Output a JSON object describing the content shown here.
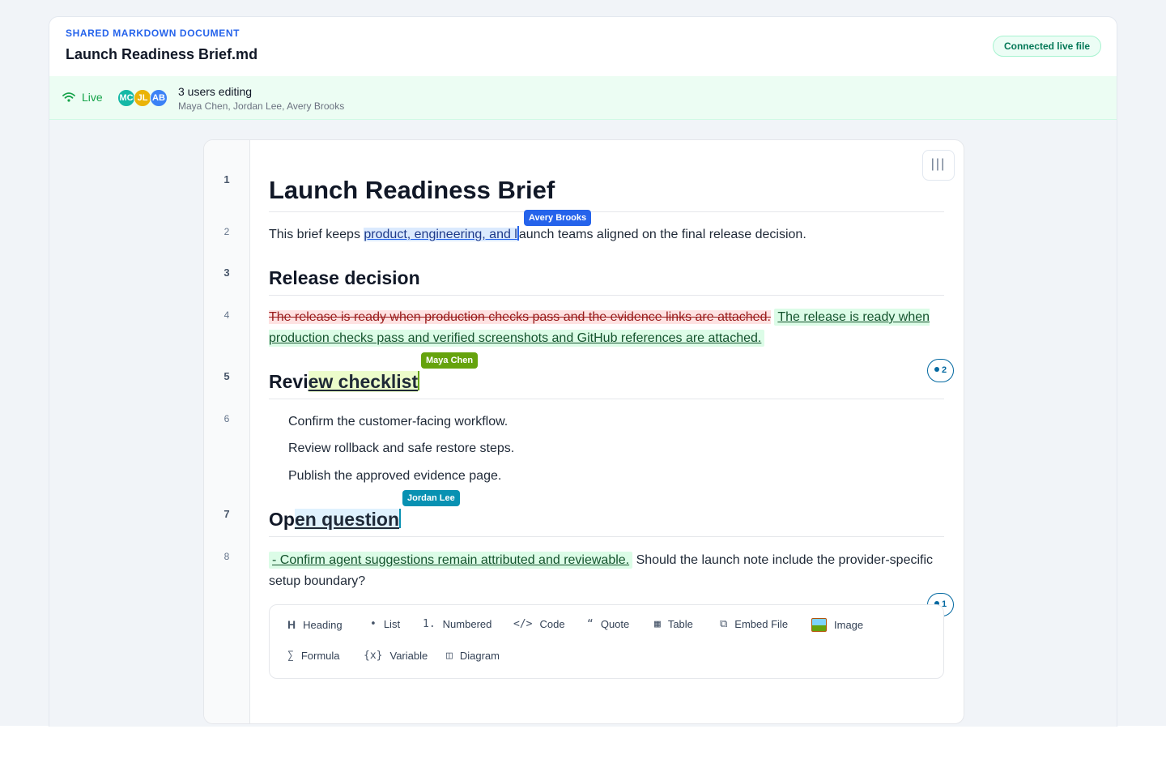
{
  "header": {
    "eyebrow": "SHARED MARKDOWN DOCUMENT",
    "title": "Launch Readiness Brief.md",
    "connection_badge": "Connected live file"
  },
  "presence": {
    "live_label": "Live",
    "avatars": [
      {
        "initials": "MC",
        "color": "#14b8a6"
      },
      {
        "initials": "JL",
        "color": "#eab308"
      },
      {
        "initials": "AB",
        "color": "#3b82f6"
      }
    ],
    "count_label": "3 users editing",
    "names": "Maya Chen, Jordan Lee, Avery Brooks"
  },
  "gutter": {
    "line_numbers": [
      "1",
      "2",
      "3",
      "4",
      "5",
      "6",
      "7",
      "8"
    ]
  },
  "toggle_icon": "column-toggle-icon",
  "doc": {
    "h1": "Launch Readiness Brief",
    "p2": {
      "before": "This brief keeps ",
      "selected": "product, engineering, and l",
      "after": "aunch teams aligned on the final release decision.",
      "cursor_user": "Avery Brooks",
      "cursor_color": "#2563eb"
    },
    "h2_release": "Release decision",
    "p4": {
      "deleted": "The release is ready when production checks pass and the evidence links are attached.",
      "inserted": "The release is ready when production checks pass and verified screenshots and GitHub references are attached."
    },
    "h2_review": {
      "plain": "Revi",
      "highlighted": "ew checklist",
      "cursor_user": "Maya Chen",
      "cursor_color": "#65a30d"
    },
    "review_comment_count": "2",
    "checklist": [
      "Confirm the customer-facing workflow.",
      "Review rollback and safe restore steps.",
      "Publish the approved evidence page."
    ],
    "h2_open": {
      "plain": "Op",
      "highlighted": "en question",
      "cursor_user": "Jordan Lee",
      "cursor_color": "#0891b2"
    },
    "p8": {
      "suggested": "- Confirm agent suggestions remain attributed and reviewable.",
      "rest": " Should the launch note include the provider-specific setup boundary?"
    },
    "open_comment_count": "1"
  },
  "toolbar": {
    "items": [
      {
        "icon": "H",
        "label": "Heading"
      },
      {
        "icon": "•",
        "label": "List"
      },
      {
        "icon": "1.",
        "label": "Numbered"
      },
      {
        "icon": "</>",
        "label": "Code"
      },
      {
        "icon": "“",
        "label": "Quote"
      },
      {
        "icon": "▦",
        "label": "Table"
      },
      {
        "icon": "⧉",
        "label": "Embed File"
      },
      {
        "icon": "",
        "label": "Image"
      },
      {
        "icon": "∑",
        "label": "Formula"
      },
      {
        "icon": "{x}",
        "label": "Variable"
      },
      {
        "icon": "◫",
        "label": "Diagram"
      }
    ]
  }
}
